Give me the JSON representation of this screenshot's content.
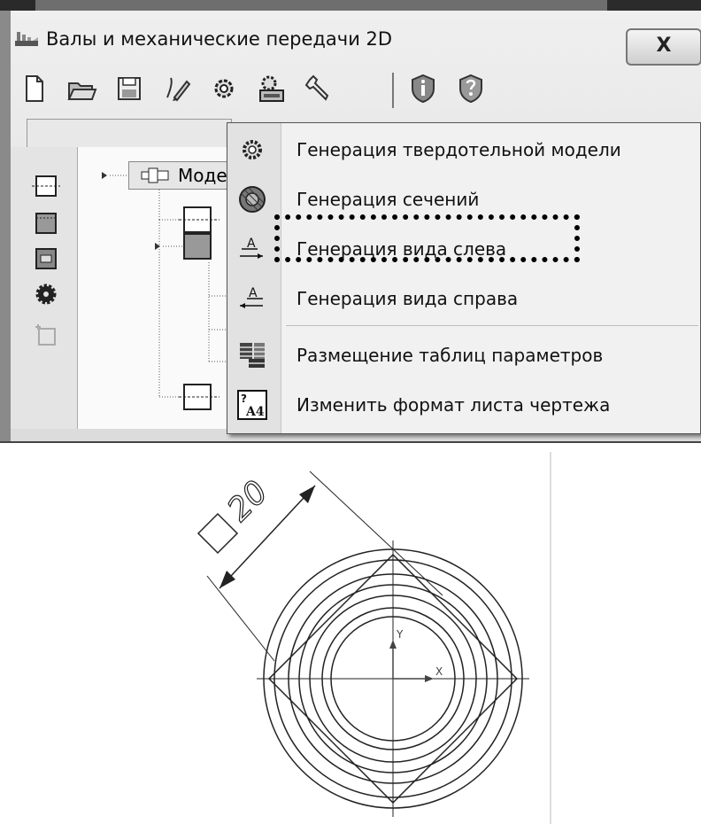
{
  "window": {
    "title": "Валы и механические передачи 2D",
    "close_glyph": "X"
  },
  "toolbar": {
    "icons": [
      "new-document-icon",
      "open-folder-icon",
      "save-icon",
      "edit-pencil-icon",
      "gear-model-icon",
      "gear-print-icon",
      "wrench-icon",
      "info-shield-icon",
      "help-shield-icon"
    ]
  },
  "tree": {
    "root_label": "Моде"
  },
  "context_menu": {
    "items": [
      {
        "label": "Генерация твердотельной модели",
        "icon": "gear-solid-icon"
      },
      {
        "label": "Генерация сечений",
        "icon": "section-circle-icon"
      },
      {
        "label": "Генерация вида слева",
        "icon": "view-left-arrow-icon",
        "icon_text": "A"
      },
      {
        "label": "Генерация вида справа",
        "icon": "view-right-arrow-icon",
        "icon_text": "A"
      },
      {
        "label": "Размещение таблиц параметров",
        "icon": "table-icon"
      },
      {
        "label": "Изменить формат листа чертежа",
        "icon": "sheet-format-icon",
        "icon_text": "A4"
      }
    ],
    "highlighted_item": "Генерация вида слева"
  },
  "drawing": {
    "dimension_text": "20",
    "axis_x_label": "X",
    "axis_y_label": "Y"
  },
  "colors": {
    "window_bg": "#d8d8d8",
    "menu_bg": "#f1f1f1",
    "line": "#111111"
  }
}
